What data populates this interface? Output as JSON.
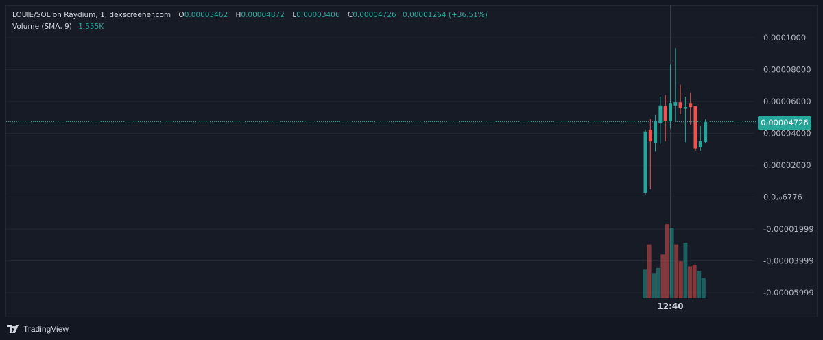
{
  "header": {
    "title": "LOUIE/SOL on Raydium, 1, dexscreener.com",
    "open_label": "O",
    "open_value": "0.00003462",
    "high_label": "H",
    "high_value": "0.00004872",
    "low_label": "L",
    "low_value": "0.00003406",
    "close_label": "C",
    "close_value": "0.00004726",
    "change": "0.00001264 (+36.51%)",
    "volume_label": "Volume (SMA, 9)",
    "volume_value": "1.555K"
  },
  "current_price_label": "0.00004726",
  "time_label": "12:40",
  "brand": "TradingView",
  "colors": {
    "up": "#26a69a",
    "down": "#ef5350",
    "background": "#171b26",
    "grid": "#232733"
  },
  "chart_data": {
    "type": "candlestick",
    "title": "LOUIE/SOL on Raydium, 1, dexscreener.com",
    "y_axis_ticks": [
      "0.0001000",
      "0.00008000",
      "0.00006000",
      "0.00004000",
      "0.00002000",
      "0.0₂₀6776",
      "-0.00001999",
      "-0.00003999",
      "-0.00005999"
    ],
    "y_axis_values": [
      0.0001,
      8e-05,
      6e-05,
      4e-05,
      2e-05,
      0.0,
      -2e-05,
      -4e-05,
      -6e-05
    ],
    "ylim": [
      -6e-05,
      0.000104
    ],
    "x_tick_label": "12:40",
    "x_tick_index": 5,
    "current_price": 4.726e-05,
    "grid": true,
    "candles": [
      {
        "o": 2.8e-06,
        "h": 4.25e-05,
        "l": 1.5e-06,
        "c": 4.12e-05,
        "dir": "up"
      },
      {
        "o": 4.22e-05,
        "h": 4.9e-05,
        "l": 5e-06,
        "c": 3.5e-05,
        "dir": "down"
      },
      {
        "o": 3.42e-05,
        "h": 5.15e-05,
        "l": 2.85e-05,
        "c": 4.8e-05,
        "dir": "up"
      },
      {
        "o": 4.62e-05,
        "h": 6.3e-05,
        "l": 3.35e-05,
        "c": 5.75e-05,
        "dir": "up"
      },
      {
        "o": 5.72e-05,
        "h": 6.4e-05,
        "l": 3.5e-05,
        "c": 4.75e-05,
        "dir": "down"
      },
      {
        "o": 4.75e-05,
        "h": 8.3e-05,
        "l": 4.3e-05,
        "c": 5.9e-05,
        "dir": "up"
      },
      {
        "o": 5.95e-05,
        "h": 9.35e-05,
        "l": 4.8e-05,
        "c": 5.75e-05,
        "dir": "up"
      },
      {
        "o": 5.95e-05,
        "h": 7.05e-05,
        "l": 5.2e-05,
        "c": 5.6e-05,
        "dir": "down"
      },
      {
        "o": 5.55e-05,
        "h": 6.3e-05,
        "l": 3.45e-05,
        "c": 5.65e-05,
        "dir": "up"
      },
      {
        "o": 5.9e-05,
        "h": 6.55e-05,
        "l": 4.55e-05,
        "c": 5.65e-05,
        "dir": "down"
      },
      {
        "o": 5.7e-05,
        "h": 5.7e-05,
        "l": 2.9e-05,
        "c": 3.05e-05,
        "dir": "down"
      },
      {
        "o": 3.12e-05,
        "h": 4.45e-05,
        "l": 2.9e-05,
        "c": 3.52e-05,
        "dir": "up"
      },
      {
        "o": 3.46e-05,
        "h": 4.88e-05,
        "l": 3.41e-05,
        "c": 4.72e-05,
        "dir": "up"
      }
    ],
    "volume": [
      {
        "v": 0.85,
        "dir": "up"
      },
      {
        "v": 1.6,
        "dir": "down"
      },
      {
        "v": 0.75,
        "dir": "up"
      },
      {
        "v": 0.9,
        "dir": "up"
      },
      {
        "v": 1.3,
        "dir": "down"
      },
      {
        "v": 2.2,
        "dir": "down"
      },
      {
        "v": 2.1,
        "dir": "up"
      },
      {
        "v": 1.6,
        "dir": "down"
      },
      {
        "v": 1.1,
        "dir": "down"
      },
      {
        "v": 1.65,
        "dir": "up"
      },
      {
        "v": 0.95,
        "dir": "down"
      },
      {
        "v": 1.0,
        "dir": "down"
      },
      {
        "v": 0.8,
        "dir": "up"
      },
      {
        "v": 0.6,
        "dir": "up"
      }
    ]
  }
}
